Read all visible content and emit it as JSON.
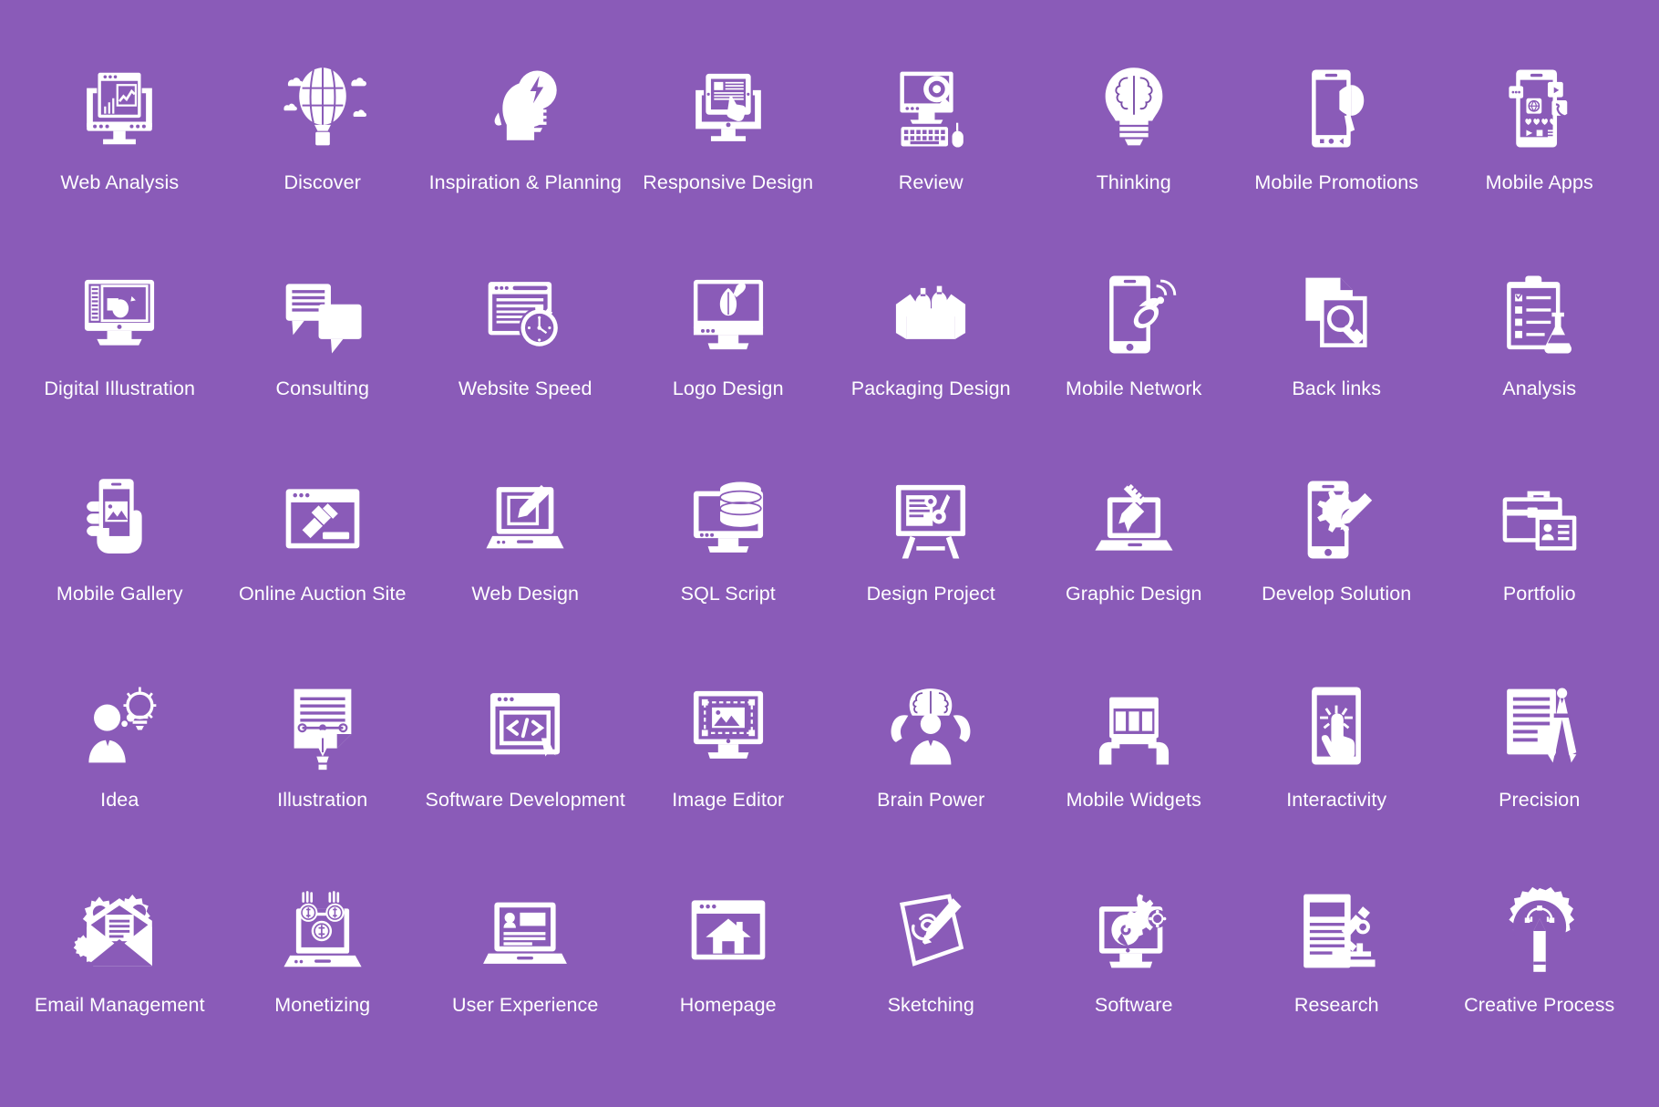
{
  "sheet": {
    "background_color": "#8a5bb8",
    "icon_color": "#ffffff",
    "columns": 8,
    "rows": 5,
    "total_icons": 40
  },
  "icons": [
    {
      "label": "Web Analysis",
      "icon_name": "web-analysis-icon"
    },
    {
      "label": "Discover",
      "icon_name": "hot-air-balloon-icon"
    },
    {
      "label": "Inspiration & Planning",
      "icon_name": "head-lightbulb-icon"
    },
    {
      "label": "Responsive Design",
      "icon_name": "responsive-design-icon"
    },
    {
      "label": "Review",
      "icon_name": "monitor-magnifier-keyboard-icon"
    },
    {
      "label": "Thinking",
      "icon_name": "brain-bulb-icon"
    },
    {
      "label": "Mobile Promotions",
      "icon_name": "phone-megaphone-icon"
    },
    {
      "label": "Mobile Apps",
      "icon_name": "phone-apps-icon"
    },
    {
      "label": "Digital Illustration",
      "icon_name": "monitor-drawing-icon"
    },
    {
      "label": "Consulting",
      "icon_name": "speech-bubbles-icon"
    },
    {
      "label": "Website Speed",
      "icon_name": "browser-stopwatch-icon"
    },
    {
      "label": "Logo Design",
      "icon_name": "monitor-brush-leaf-icon"
    },
    {
      "label": "Packaging Design",
      "icon_name": "open-box-bottles-icon"
    },
    {
      "label": "Mobile Network",
      "icon_name": "phone-satellite-icon"
    },
    {
      "label": "Back links",
      "icon_name": "documents-link-icon"
    },
    {
      "label": "Analysis",
      "icon_name": "clipboard-flask-icon"
    },
    {
      "label": "Mobile Gallery",
      "icon_name": "hand-phone-photo-icon"
    },
    {
      "label": "Online Auction Site",
      "icon_name": "browser-gavel-icon"
    },
    {
      "label": "Web Design",
      "icon_name": "laptop-pen-icon"
    },
    {
      "label": "SQL Script",
      "icon_name": "monitor-database-icon"
    },
    {
      "label": "Design Project",
      "icon_name": "easel-board-icon"
    },
    {
      "label": "Graphic Design",
      "icon_name": "laptop-pencil-ruler-icon"
    },
    {
      "label": "Develop Solution",
      "icon_name": "phone-gear-pencil-icon"
    },
    {
      "label": "Portfolio",
      "icon_name": "briefcase-id-icon"
    },
    {
      "label": "Idea",
      "icon_name": "person-idea-bulb-icon"
    },
    {
      "label": "Illustration",
      "icon_name": "document-pen-nib-icon"
    },
    {
      "label": "Software Development",
      "icon_name": "browser-code-cursor-icon"
    },
    {
      "label": "Image Editor",
      "icon_name": "monitor-image-crop-icon"
    },
    {
      "label": "Brain Power",
      "icon_name": "brain-muscle-icon"
    },
    {
      "label": "Mobile Widgets",
      "icon_name": "hands-widget-grid-icon"
    },
    {
      "label": "Interactivity",
      "icon_name": "tablet-touch-icon"
    },
    {
      "label": "Precision",
      "icon_name": "document-compass-icon"
    },
    {
      "label": "Email Management",
      "icon_name": "envelope-gears-icon"
    },
    {
      "label": "Monetizing",
      "icon_name": "laptop-coins-icon"
    },
    {
      "label": "User Experience",
      "icon_name": "laptop-profile-icon"
    },
    {
      "label": "Homepage",
      "icon_name": "browser-house-icon"
    },
    {
      "label": "Sketching",
      "icon_name": "paper-pencil-sketch-icon"
    },
    {
      "label": "Software",
      "icon_name": "monitor-disc-gear-icon"
    },
    {
      "label": "Research",
      "icon_name": "document-microscope-icon"
    },
    {
      "label": "Creative Process",
      "icon_name": "gear-pencil-bezier-icon"
    }
  ]
}
